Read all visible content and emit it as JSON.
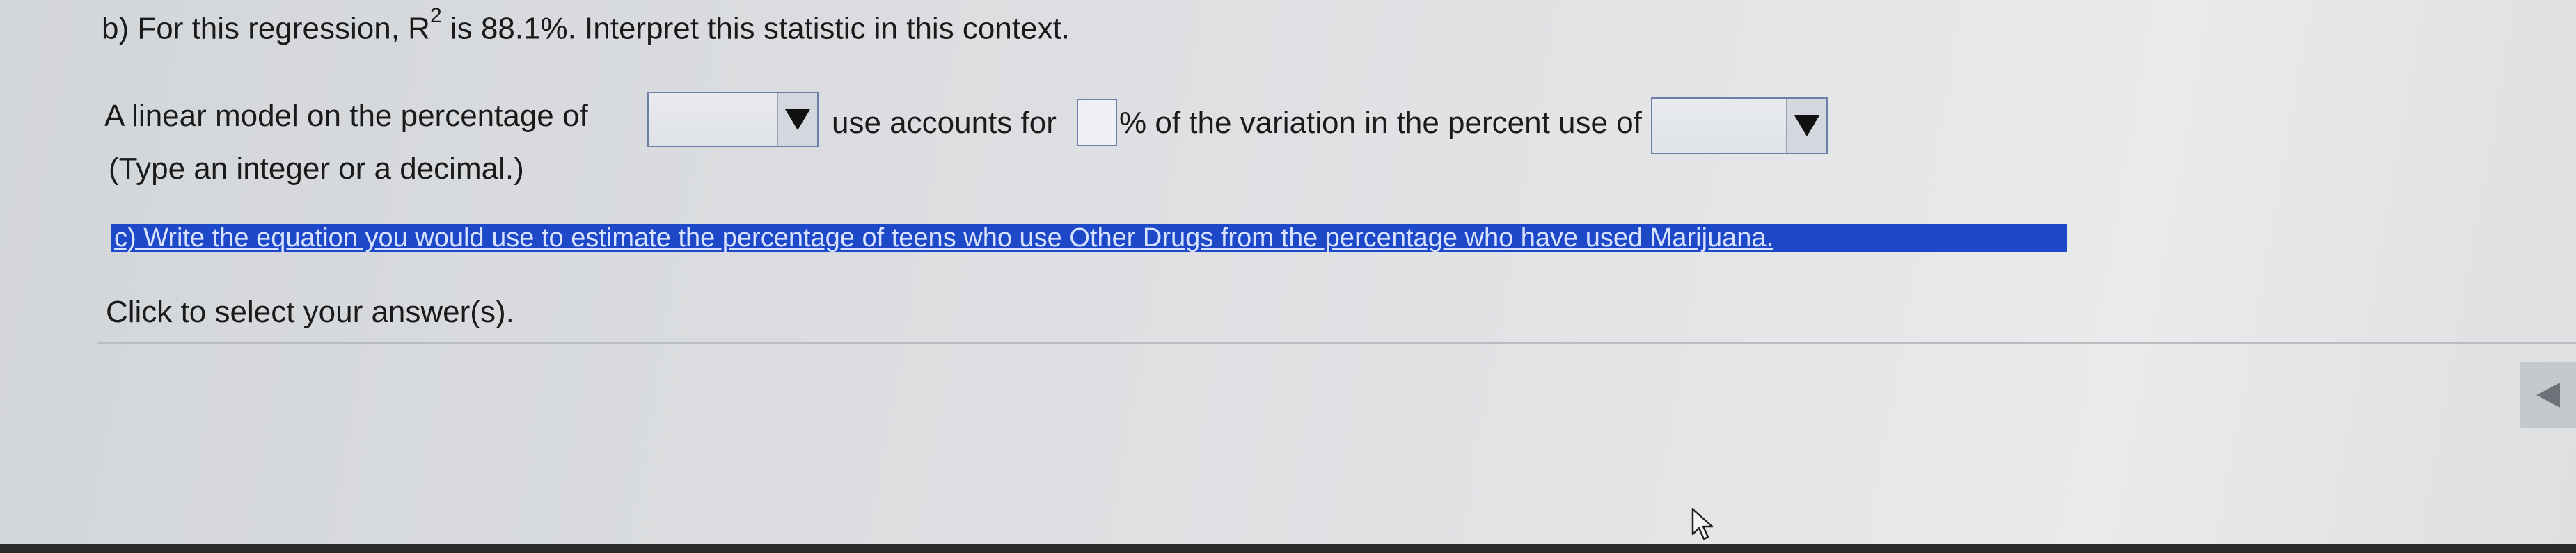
{
  "part_b": {
    "prefix": "b) For this regression, R",
    "superscript": "2",
    "suffix": " is 88.1%. Interpret this statistic in this context."
  },
  "sentence": {
    "part1": "A linear model on the percentage of",
    "dropdown1_value": "",
    "part2": "use accounts for",
    "input_value": "",
    "part3": "% of the variation in the percent use of",
    "dropdown2_value": ""
  },
  "hint": "(Type an integer or a decimal.)",
  "part_c": "c) Write the equation you would use to estimate the percentage of teens who use Other Drugs from the percentage who have used Marijuana.",
  "answer_prompt": "Click to select your answer(s)."
}
